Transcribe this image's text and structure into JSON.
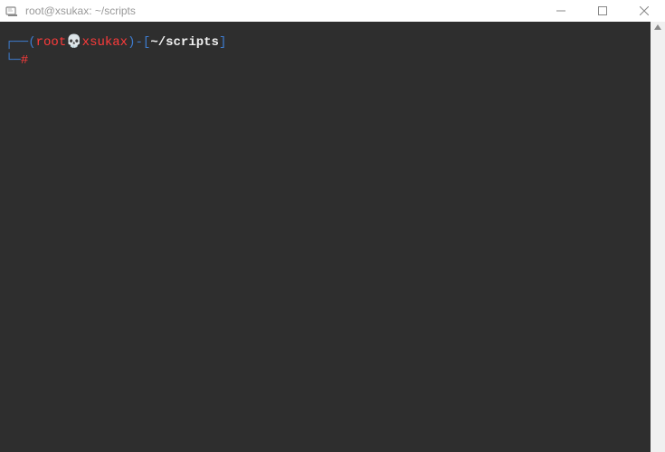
{
  "titlebar": {
    "title": "root@xsukax: ~/scripts"
  },
  "terminal": {
    "prompt": {
      "box_top": "┌──",
      "lparen": "(",
      "user": "root",
      "skull": "💀",
      "host": "xsukax",
      "rparen": ")",
      "dash": "-",
      "lbrack": "[",
      "path": "~/scripts",
      "rbrack": "]",
      "box_bot": "└─",
      "hash": "#"
    }
  },
  "colors": {
    "bg": "#2e2e2e",
    "blue": "#3e7ccf",
    "red": "#ff3b3b",
    "white": "#f0f0f0"
  }
}
